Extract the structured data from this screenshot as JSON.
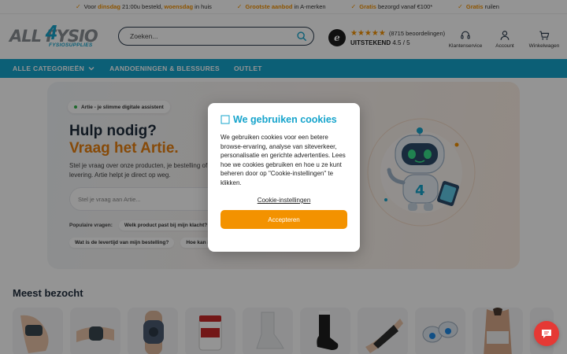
{
  "usp": [
    {
      "pre": "Voor ",
      "hl1": "dinsdag",
      "mid": " 21:00u besteld, ",
      "hl2": "woensdag",
      "post": " in huis"
    },
    {
      "pre": "",
      "hl1": "Grootste aanbod",
      "mid": " in A-merken",
      "hl2": "",
      "post": ""
    },
    {
      "pre": "",
      "hl1": "Gratis",
      "mid": " bezorgd vanaf €100*",
      "hl2": "",
      "post": ""
    },
    {
      "pre": "",
      "hl1": "Gratis",
      "mid": " ruilen",
      "hl2": "",
      "post": ""
    }
  ],
  "logo": {
    "main": "ALL FYSIO",
    "four": "4",
    "sub": "FYSIOSUPPLIES"
  },
  "search": {
    "placeholder": "Zoeken..."
  },
  "rating": {
    "badge": "e",
    "stars": "★★★★★",
    "reviews": "(8715 beoordelingen)",
    "label": "UITSTEKEND",
    "score": "4.5 / 5"
  },
  "header_icons": {
    "service": "Klantenservice",
    "account": "Account",
    "cart": "Winkelwagen"
  },
  "nav": {
    "categories": "ALLE CATEGORIEËN",
    "conditions": "AANDOENINGEN & BLESSURES",
    "outlet": "OUTLET"
  },
  "hero": {
    "pill": "Artie - je slimme digitale assistent",
    "title1": "Hulp nodig?",
    "title2": "Vraag het Artie.",
    "desc": "Stel je vraag over onze producten, je bestelling of levering. Artie helpt je direct op weg.",
    "ask_placeholder": "Stel je vraag aan Artie...",
    "popular_label": "Populaire vragen:",
    "chip1": "Welk product past bij mijn klacht?",
    "chip2": "Wat is de levertijd van mijn bestelling?",
    "chip3": "Hoe kan ik retourneren?"
  },
  "section": {
    "title": "Meest bezocht"
  },
  "cookie": {
    "title": "We gebruiken cookies",
    "title_icon": "cookie-icon",
    "body": "We gebruiken cookies voor een betere browse-ervaring, analyse van siteverkeer, personalisatie en gerichte advertenties. Lees hoe we cookies gebruiken en hoe u ze kunt beheren door op \"Cookie-instellingen\" te klikken.",
    "settings": "Cookie-instellingen",
    "accept": "Accepteren"
  },
  "colors": {
    "brand_blue": "#16a4cc",
    "accent_orange": "#f39200",
    "chat_red": "#e53935"
  }
}
